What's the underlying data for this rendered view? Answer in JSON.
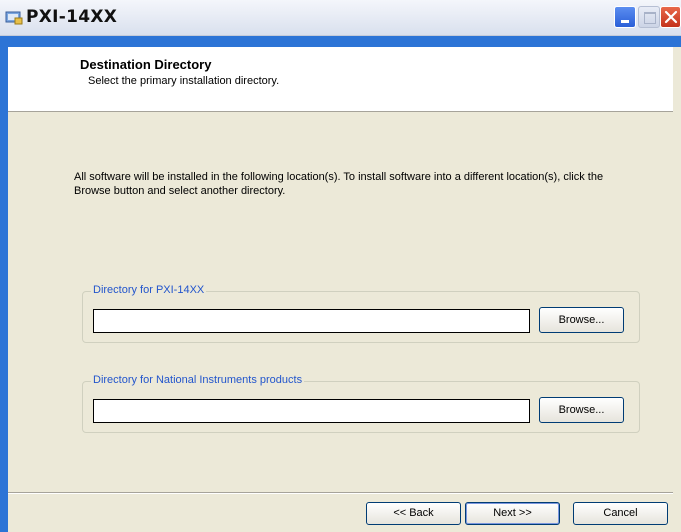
{
  "window": {
    "title": "PXI-14XX",
    "icon": "installer-icon",
    "controls": [
      "minimize-icon",
      "maximize-icon",
      "close-icon"
    ]
  },
  "header": {
    "title": "Destination Directory",
    "subtitle": "Select the primary installation directory."
  },
  "body": {
    "intro": "All software will be installed in the following location(s). To install software into a different location(s), click the Browse button and select another directory."
  },
  "directories": [
    {
      "label": "Directory for PXI-14XX",
      "value": "",
      "browse_label": "Browse..."
    },
    {
      "label": "Directory for National Instruments products",
      "value": "",
      "browse_label": "Browse..."
    }
  ],
  "footer": {
    "back_label": "<< Back",
    "next_label": "Next >>",
    "cancel_label": "Cancel"
  },
  "colors": {
    "accent": "#2c74d6",
    "group_label": "#2255cc",
    "dialog_bg": "#ece9d8"
  }
}
